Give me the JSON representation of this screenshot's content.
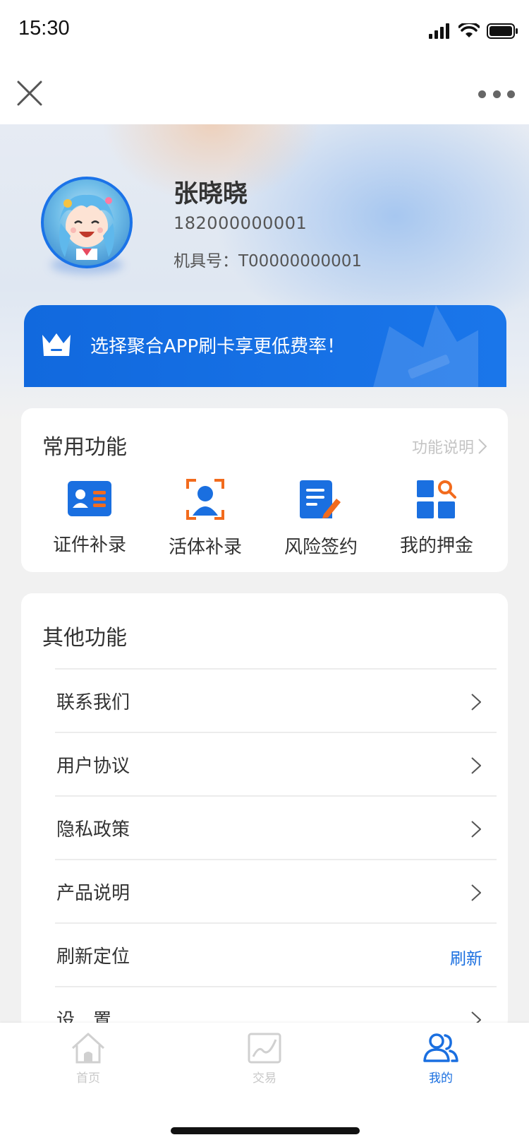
{
  "status_bar": {
    "time": "15:30"
  },
  "profile": {
    "name": "张晓晓",
    "phone": "182000000001",
    "device_label": "机具号：",
    "device_id": "T00000000001"
  },
  "promo": {
    "text": "选择聚合APP刷卡享更低费率！"
  },
  "common_functions": {
    "title": "常用功能",
    "help_link": "功能说明",
    "items": [
      {
        "label": "证件补录",
        "icon": "id-card-icon"
      },
      {
        "label": "活体补录",
        "icon": "face-scan-icon"
      },
      {
        "label": "风险签约",
        "icon": "sign-document-icon"
      },
      {
        "label": "我的押金",
        "icon": "deposit-grid-icon"
      }
    ]
  },
  "other_functions": {
    "title": "其他功能",
    "items": [
      {
        "label": "联系我们"
      },
      {
        "label": "用户协议"
      },
      {
        "label": "隐私政策"
      },
      {
        "label": "产品说明"
      },
      {
        "label": "刷新定位",
        "action": "刷新"
      },
      {
        "label": "设　置"
      }
    ]
  },
  "tab_bar": {
    "tabs": [
      {
        "label": "首页",
        "icon": "home-icon",
        "active": false
      },
      {
        "label": "交易",
        "icon": "chart-icon",
        "active": false
      },
      {
        "label": "我的",
        "icon": "users-icon",
        "active": true
      }
    ]
  },
  "colors": {
    "primary": "#1a6fe0",
    "accent_orange": "#f26b1d",
    "text": "#333333"
  }
}
